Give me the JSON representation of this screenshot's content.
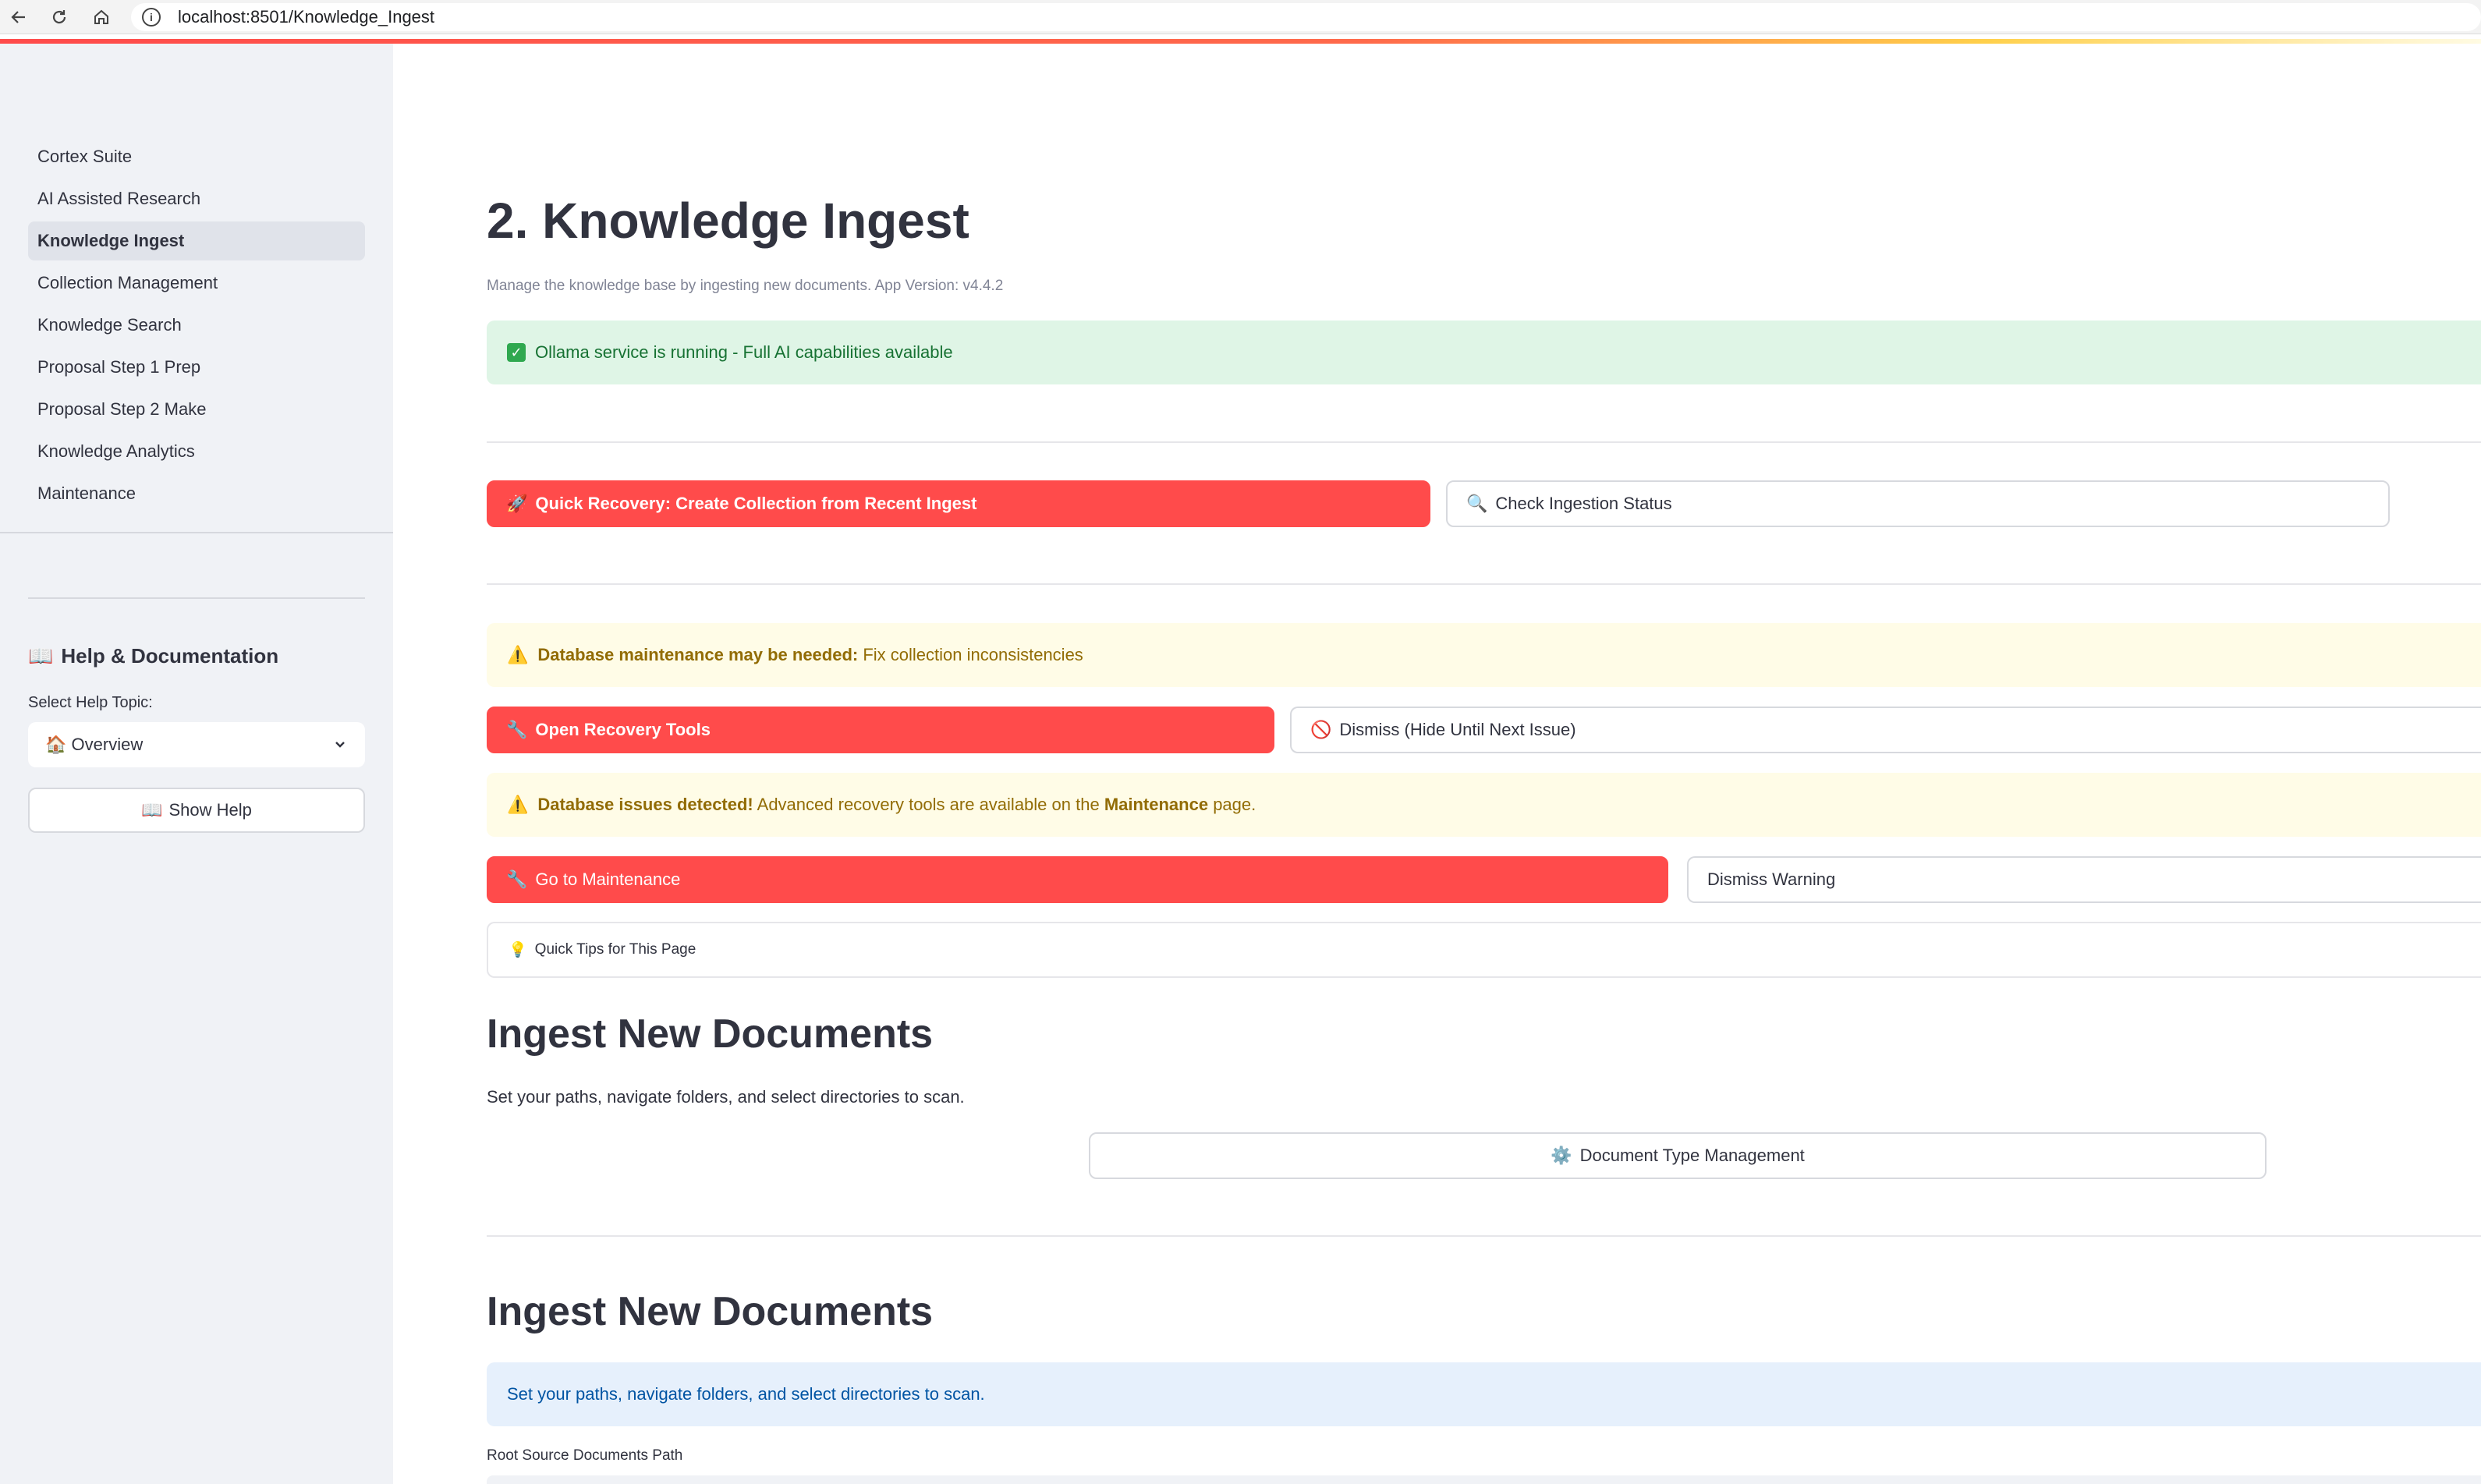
{
  "browser": {
    "url": "localhost:8501/Knowledge_Ingest",
    "back_icon": "arrow-left",
    "reload_icon": "reload",
    "home_icon": "home"
  },
  "sidebar": {
    "nav_items": [
      {
        "label": "Cortex Suite"
      },
      {
        "label": "AI Assisted Research"
      },
      {
        "label": "Knowledge Ingest",
        "active": true
      },
      {
        "label": "Collection Management"
      },
      {
        "label": "Knowledge Search"
      },
      {
        "label": "Proposal Step 1 Prep"
      },
      {
        "label": "Proposal Step 2 Make"
      },
      {
        "label": "Knowledge Analytics"
      },
      {
        "label": "Maintenance"
      }
    ],
    "help": {
      "icon": "📖",
      "title": "Help & Documentation",
      "select_label": "Select Help Topic:",
      "selected_icon": "🏠",
      "selected_topic": "Overview",
      "show_help_icon": "📖",
      "show_help_label": "Show Help"
    }
  },
  "main": {
    "title": "2. Knowledge Ingest",
    "caption": "Manage the knowledge base by ingesting new documents. App Version: v4.4.2",
    "status_alert": {
      "icon": "✓",
      "text": "Ollama service is running - Full AI capabilities available"
    },
    "recovery": {
      "quick_icon": "🚀",
      "quick_label": "Quick Recovery: Create Collection from Recent Ingest",
      "check_icon": "🔍",
      "check_label": "Check Ingestion Status"
    },
    "maintenance_warning": {
      "icon": "⚠️",
      "bold": "Database maintenance may be needed:",
      "text": " Fix collection inconsistencies"
    },
    "recovery_tools": {
      "open_icon": "🔧",
      "open_label": "Open Recovery Tools",
      "dismiss_icon": "🚫",
      "dismiss_label": "Dismiss (Hide Until Next Issue)"
    },
    "issues_warning": {
      "icon": "⚠️",
      "bold": "Database issues detected!",
      "text_before": " Advanced recovery tools are available on the ",
      "link_bold": "Maintenance",
      "text_after": " page."
    },
    "maintenance_actions": {
      "goto_icon": "🔧",
      "goto_label": "Go to Maintenance",
      "dismiss_label": "Dismiss Warning"
    },
    "tips": {
      "icon": "💡",
      "label": "Quick Tips for This Page"
    },
    "section1": {
      "heading": "Ingest New Documents",
      "text": "Set your paths, navigate folders, and select directories to scan.",
      "doc_type_icon": "⚙️",
      "doc_type_label": "Document Type Management"
    },
    "section2": {
      "heading": "Ingest New Documents",
      "info": "Set your paths, navigate folders, and select directories to scan.",
      "field_label": "Root Source Documents Path"
    }
  }
}
